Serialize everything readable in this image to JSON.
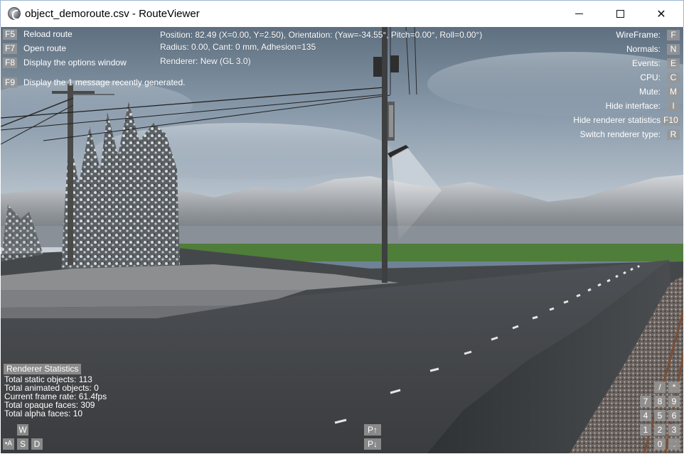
{
  "window": {
    "title": "object_demoroute.csv - RouteViewer",
    "min_glyph": "—",
    "max_glyph": "☐",
    "close_glyph": "✕"
  },
  "shortcuts_left": [
    {
      "key": "F5",
      "label": "Reload route"
    },
    {
      "key": "F7",
      "label": "Open route"
    },
    {
      "key": "F8",
      "label": "Display the options window"
    },
    {
      "key": "F9",
      "label": "Display the 1 message recently generated."
    }
  ],
  "info": {
    "position": "Position: 82.49 (X=0.00, Y=2.50), Orientation: (Yaw=-34.55°, Pitch=0.00°, Roll=0.00°)",
    "radius": "Radius: 0.00, Cant: 0 mm, Adhesion=135",
    "renderer": "Renderer: New (GL 3.0)"
  },
  "toggles_right": [
    {
      "label": "WireFrame:",
      "key": "F"
    },
    {
      "label": "Normals:",
      "key": "N"
    },
    {
      "label": "Events:",
      "key": "E"
    },
    {
      "label": "CPU:",
      "key": "C"
    },
    {
      "label": "Mute:",
      "key": "M"
    },
    {
      "label": "Hide interface:",
      "key": "I"
    },
    {
      "label": "Hide renderer statistics",
      "key": "F10"
    },
    {
      "label": "Switch renderer type:",
      "key": "R"
    }
  ],
  "stats": {
    "heading": "Renderer Statistics",
    "lines": [
      "Total static objects: 113",
      "Total animated objects: 0",
      "Current frame rate: 61.4fps",
      "Total opaque faces: 309",
      "Total alpha faces: 10"
    ]
  },
  "movement_keys": {
    "w": "W",
    "a": "A",
    "s": "S",
    "d": "D",
    "a_prefix": "•"
  },
  "page_keys": {
    "up": "P↑",
    "down": "P↓"
  },
  "numpad": {
    "row0": [
      "/",
      "*"
    ],
    "row1": [
      "7",
      "8",
      "9"
    ],
    "row2": [
      "4",
      "5",
      "6"
    ],
    "row3": [
      "1",
      "2",
      "3"
    ],
    "row4": [
      "0",
      "."
    ]
  },
  "colors": {
    "overlay_key_bg": "#969696",
    "sky": "#6f8396",
    "grass": "#4f7d3a",
    "platform": "#3d3f42"
  }
}
